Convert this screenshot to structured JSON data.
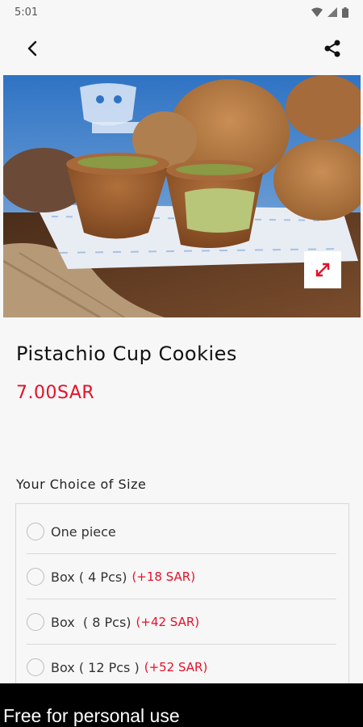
{
  "status_bar": {
    "time": "5:01"
  },
  "toolbar": {
    "back_icon": "back-arrow-icon",
    "share_icon": "share-icon"
  },
  "hero": {
    "expand_icon": "expand-icon"
  },
  "product": {
    "name": "Pistachio Cup Cookies",
    "price": "7.00SAR"
  },
  "size_section": {
    "title": "Your Choice of Size",
    "options": [
      {
        "label": "One piece",
        "extra": ""
      },
      {
        "label": "Box ( 4 Pcs)",
        "extra": "(+18 SAR)"
      },
      {
        "label": "Box  ( 8 Pcs)",
        "extra": "(+42 SAR)"
      },
      {
        "label": "Box ( 12 Pcs )",
        "extra": "(+52 SAR)"
      }
    ]
  },
  "watermark": "Free for personal use",
  "colors": {
    "accent": "#e3122a",
    "background": "#f7f7f7"
  }
}
